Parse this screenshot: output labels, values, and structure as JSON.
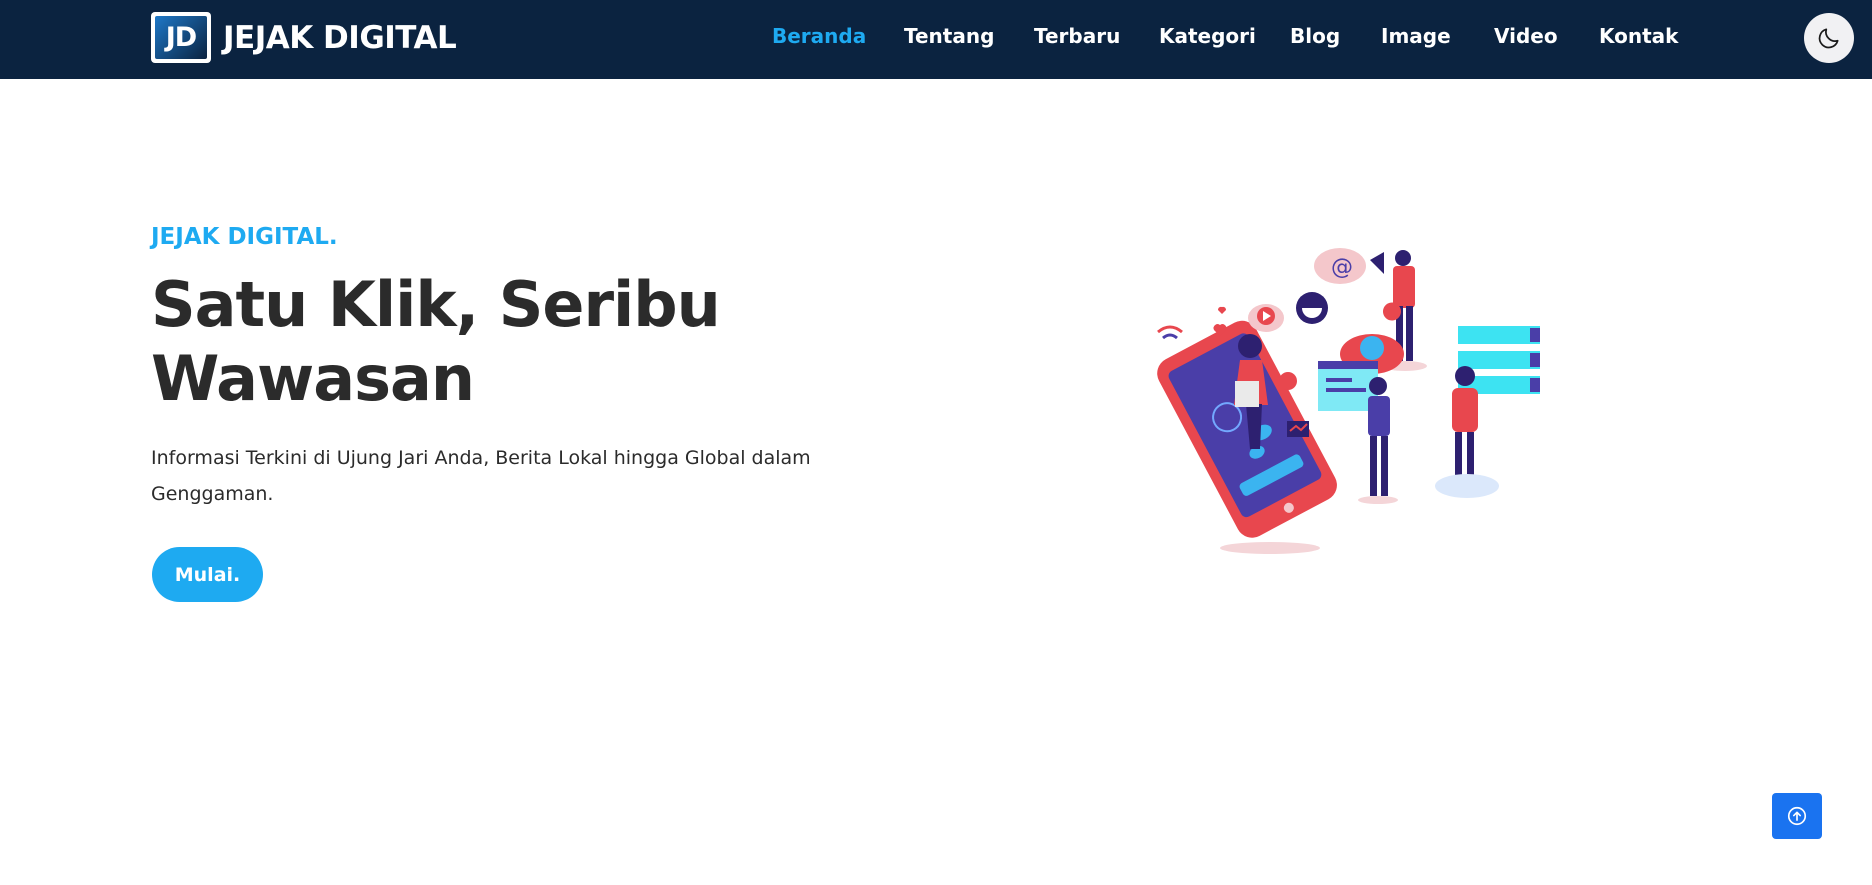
{
  "brand": {
    "logo_text": "JD",
    "name": "JEJAK DIGITAL"
  },
  "nav": {
    "items": [
      {
        "label": "Beranda",
        "active": true
      },
      {
        "label": "Tentang",
        "active": false
      },
      {
        "label": "Terbaru",
        "active": false
      },
      {
        "label": "Kategori",
        "active": false
      },
      {
        "label": "Blog",
        "active": false
      },
      {
        "label": "Image",
        "active": false
      },
      {
        "label": "Video",
        "active": false
      },
      {
        "label": "Kontak",
        "active": false
      }
    ],
    "theme_toggle_icon": "moon-icon"
  },
  "hero": {
    "eyebrow": "JEJAK DIGITAL.",
    "title_line1": "Satu Klik, Seribu",
    "title_line2": "Wawasan",
    "description": "Informasi Terkini di Ujung Jari Anda, Berita Lokal hingga Global dalam Genggaman.",
    "button_label": "Mulai.",
    "illustration_icon": "social-media-illustration"
  },
  "scroll_top_icon": "arrow-up-circle-icon",
  "colors": {
    "navbar_bg": "#0b2340",
    "accent": "#1eaaf1",
    "scroll_top_bg": "#1a73f0",
    "text_dark": "#2b2b2b"
  }
}
